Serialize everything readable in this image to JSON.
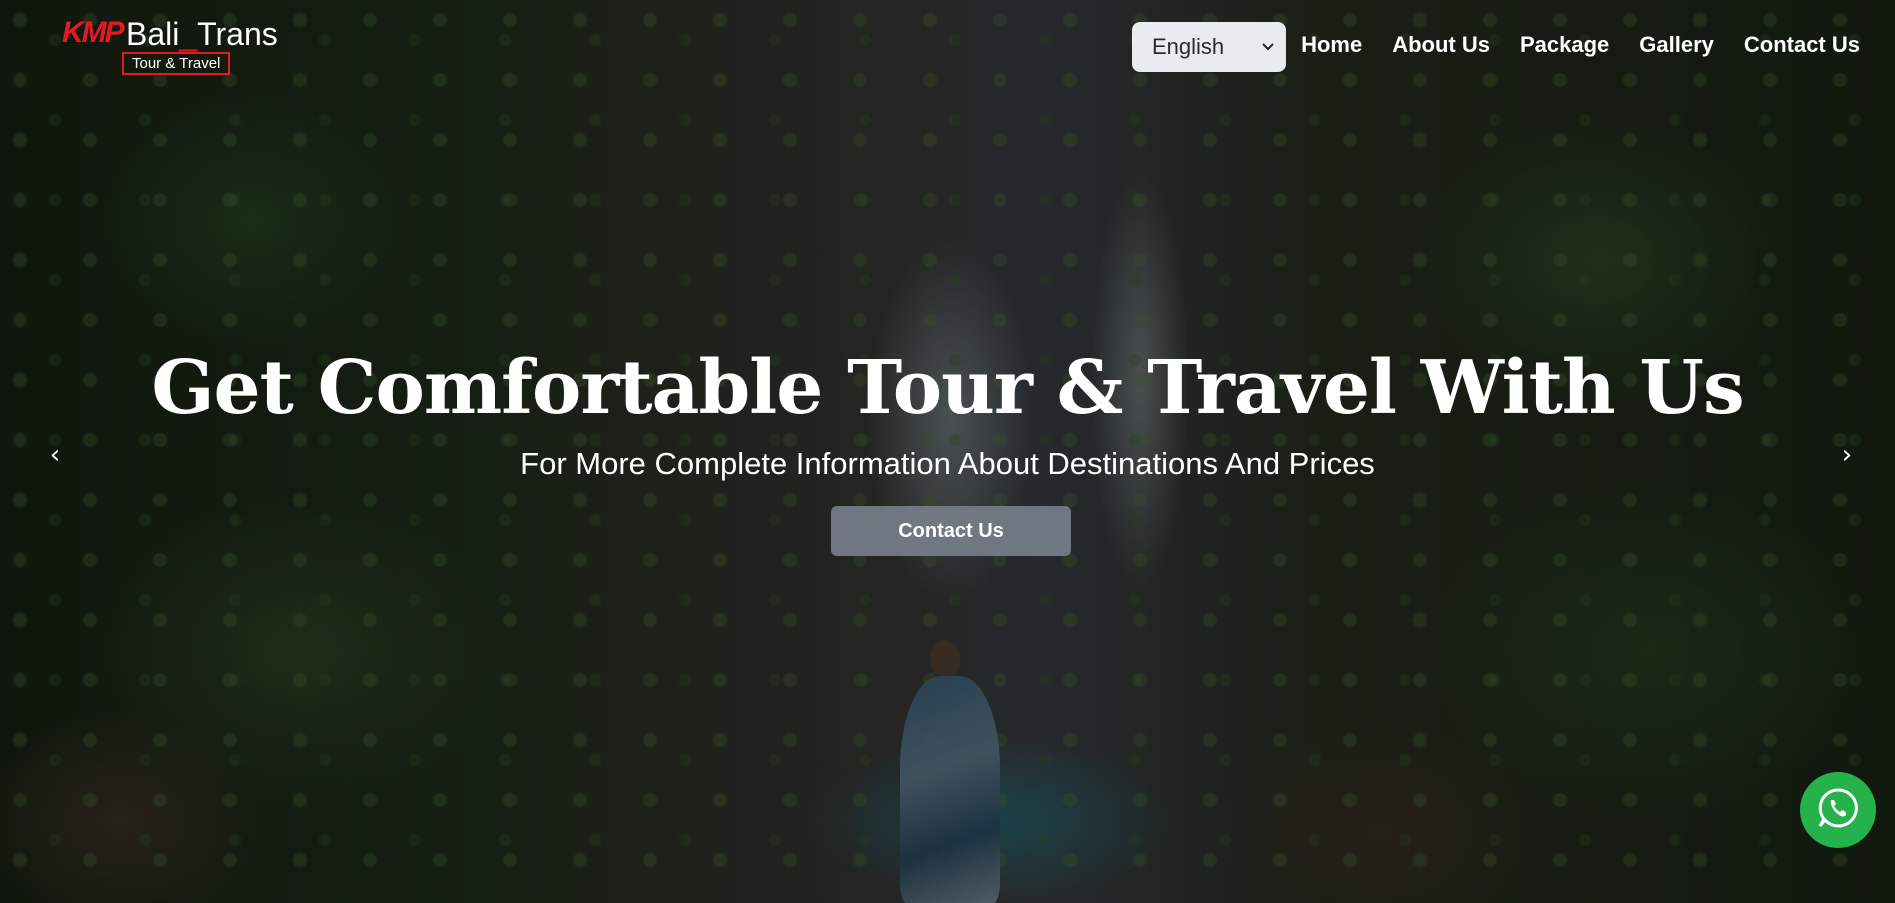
{
  "header": {
    "logo": {
      "mark": "KMP",
      "name_part1": "Bali",
      "name_part2": "Trans",
      "tagline": "Tour & Travel"
    },
    "language": {
      "selected": "English"
    },
    "nav": [
      {
        "label": "Home"
      },
      {
        "label": "About Us"
      },
      {
        "label": "Package"
      },
      {
        "label": "Gallery"
      },
      {
        "label": "Contact Us"
      }
    ]
  },
  "hero": {
    "title": "Get Comfortable Tour & Travel With Us",
    "subtitle": "For More Complete Information About Destinations And Prices",
    "button_label": "Contact Us",
    "prev_icon": "‹",
    "next_icon": "›"
  },
  "icons": {
    "prev": "chevron-left-icon",
    "next": "chevron-right-icon",
    "whatsapp": "whatsapp-icon",
    "select": "chevron-down-icon"
  },
  "colors": {
    "brand_red": "#e21b23",
    "whatsapp_green": "#25b24a",
    "button_gray": "#78808c"
  }
}
